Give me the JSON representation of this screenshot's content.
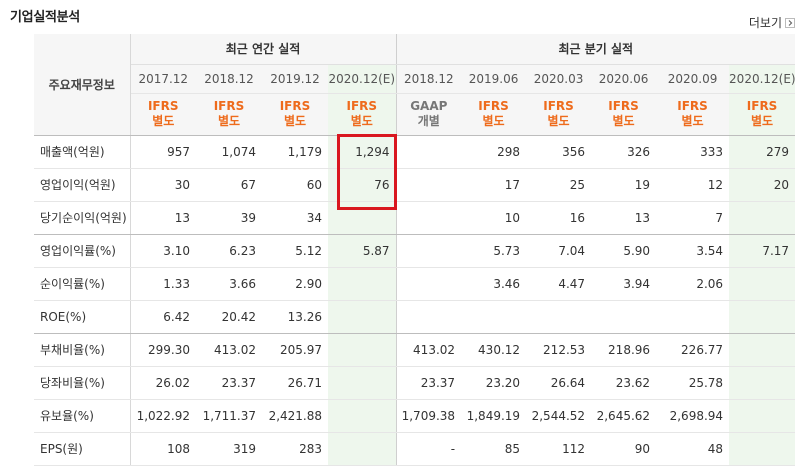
{
  "section_title": "기업실적분석",
  "more_link": "더보기",
  "label_header": "주요재무정보",
  "groups": {
    "annual": "최근 연간 실적",
    "quarterly": "최근 분기 실적"
  },
  "periods": [
    "2017.12",
    "2018.12",
    "2019.12",
    "2020.12(E)",
    "2018.12",
    "2019.06",
    "2020.03",
    "2020.06",
    "2020.09",
    "2020.12(E)"
  ],
  "standards": [
    [
      "IFRS",
      "별도"
    ],
    [
      "IFRS",
      "별도"
    ],
    [
      "IFRS",
      "별도"
    ],
    [
      "IFRS",
      "별도"
    ],
    [
      "GAAP",
      "개별"
    ],
    [
      "IFRS",
      "별도"
    ],
    [
      "IFRS",
      "별도"
    ],
    [
      "IFRS",
      "별도"
    ],
    [
      "IFRS",
      "별도"
    ],
    [
      "IFRS",
      "별도"
    ]
  ],
  "rows": [
    {
      "label": "매출액(억원)",
      "values": [
        "957",
        "1,074",
        "1,179",
        "1,294",
        "",
        "298",
        "356",
        "326",
        "333",
        "279"
      ]
    },
    {
      "label": "영업이익(억원)",
      "values": [
        "30",
        "67",
        "60",
        "76",
        "",
        "17",
        "25",
        "19",
        "12",
        "20"
      ]
    },
    {
      "label": "당기순이익(억원)",
      "values": [
        "13",
        "39",
        "34",
        "",
        "",
        "10",
        "16",
        "13",
        "7",
        ""
      ]
    },
    {
      "label": "영업이익률(%)",
      "values": [
        "3.10",
        "6.23",
        "5.12",
        "5.87",
        "",
        "5.73",
        "7.04",
        "5.90",
        "3.54",
        "7.17"
      ]
    },
    {
      "label": "순이익률(%)",
      "values": [
        "1.33",
        "3.66",
        "2.90",
        "",
        "",
        "3.46",
        "4.47",
        "3.94",
        "2.06",
        ""
      ]
    },
    {
      "label": "ROE(%)",
      "values": [
        "6.42",
        "20.42",
        "13.26",
        "",
        "",
        "",
        "",
        "",
        "",
        ""
      ]
    },
    {
      "label": "부채비율(%)",
      "values": [
        "299.30",
        "413.02",
        "205.97",
        "",
        "413.02",
        "430.12",
        "212.53",
        "218.96",
        "226.77",
        ""
      ]
    },
    {
      "label": "당좌비율(%)",
      "values": [
        "26.02",
        "23.37",
        "26.71",
        "",
        "23.37",
        "23.20",
        "26.64",
        "23.62",
        "25.78",
        ""
      ]
    },
    {
      "label": "유보율(%)",
      "values": [
        "1,022.92",
        "1,711.37",
        "2,421.88",
        "",
        "1,709.38",
        "1,849.19",
        "2,544.52",
        "2,645.62",
        "2,698.94",
        ""
      ]
    },
    {
      "label": "EPS(원)",
      "values": [
        "108",
        "319",
        "283",
        "",
        "-",
        "85",
        "112",
        "90",
        "48",
        ""
      ]
    }
  ],
  "colors": {
    "ifrs": "#ee6b1c",
    "gaap": "#777777",
    "estimate_bg": "#eef7ed",
    "highlight_border": "#d9171f"
  }
}
